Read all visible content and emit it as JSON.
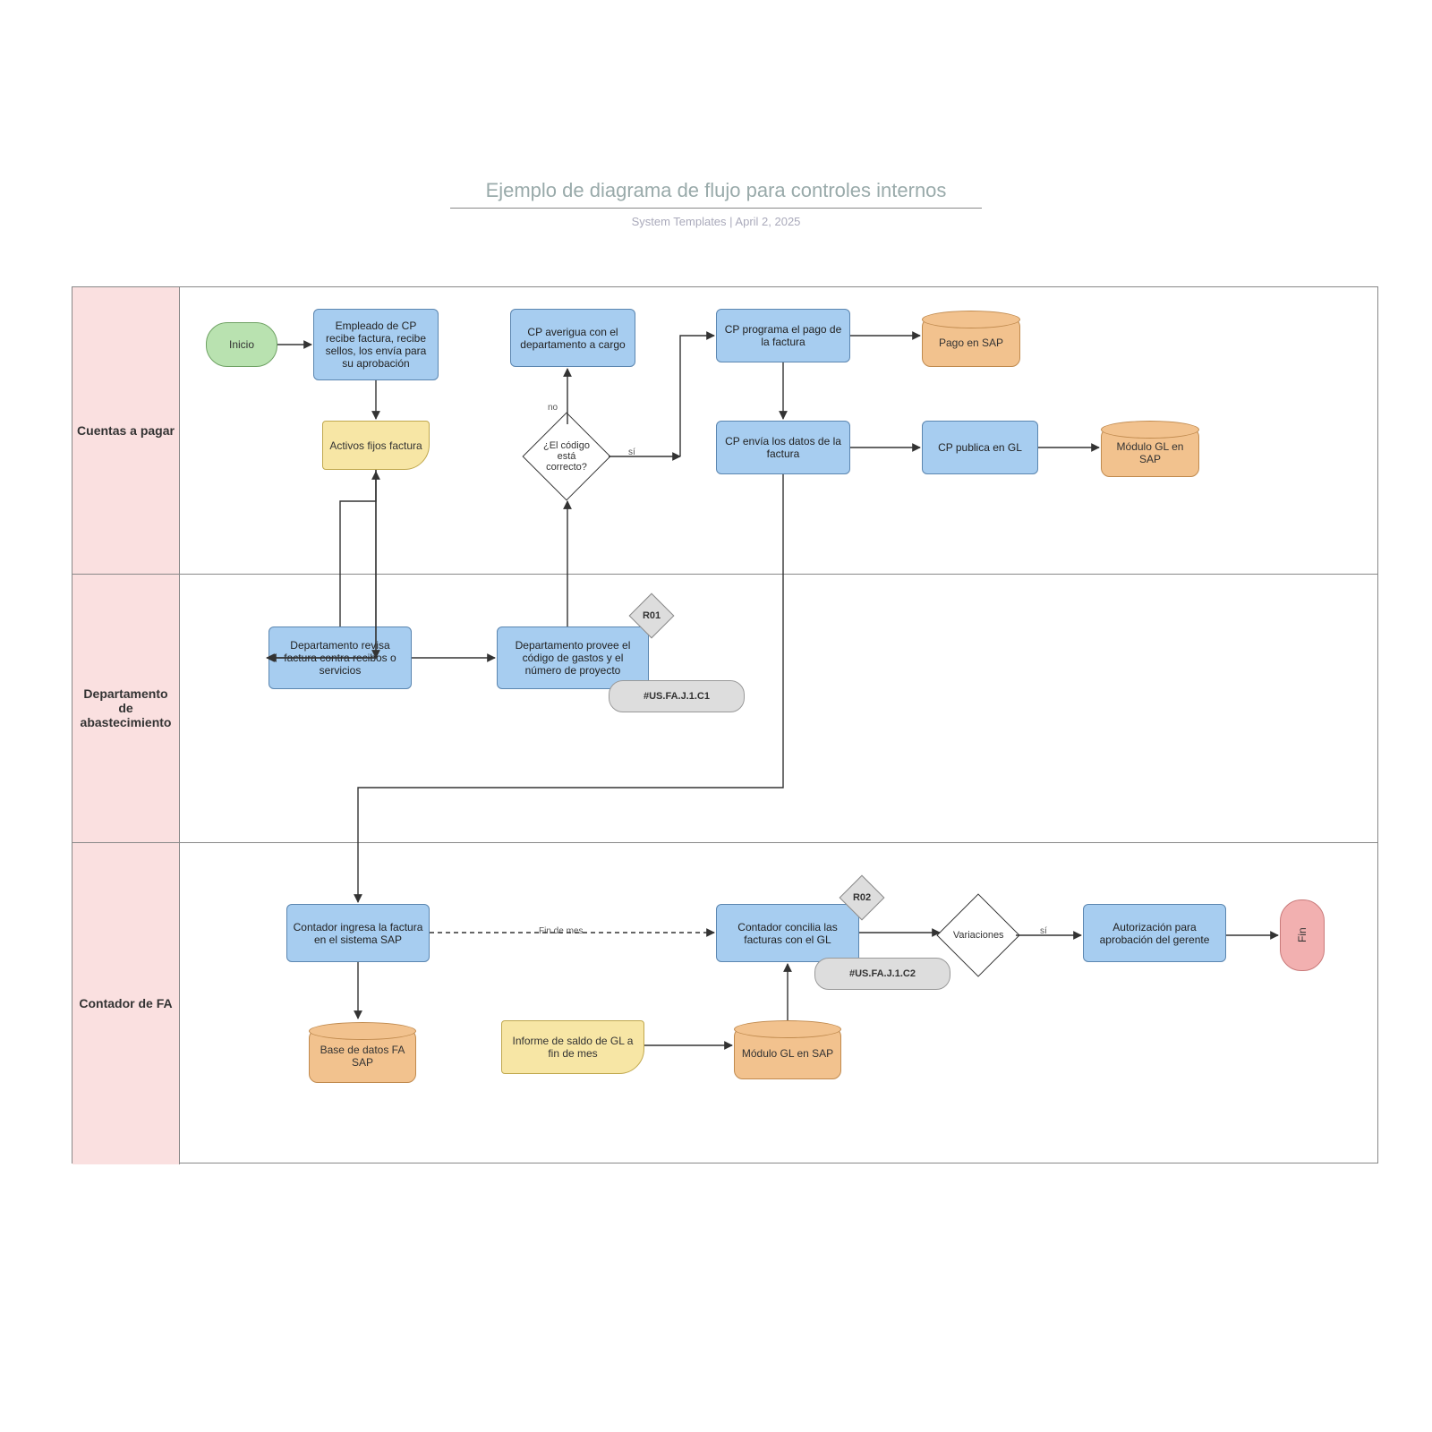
{
  "title": "Ejemplo de diagrama de flujo para controles internos",
  "meta": {
    "author": "System Templates",
    "date": "April 2, 2025",
    "sep": "  |  "
  },
  "lanes": {
    "l1": "Cuentas a pagar",
    "l2": "Departamento de abastecimiento",
    "l3": "Contador de FA"
  },
  "nodes": {
    "start": "Inicio",
    "end": "Fin",
    "p1": "Empleado de CP recibe factura, recibe sellos, los envía para su aprobación",
    "d1": "Activos fijos factura",
    "p2": "CP averigua con el departamento a cargo",
    "q1": "¿El código está correcto?",
    "p3": "CP programa el pago de la factura",
    "c1": "Pago en SAP",
    "p4": "CP envía los datos de la factura",
    "p5": "CP publica en GL",
    "c2": "Módulo GL en SAP",
    "p6": "Departamento revisa factura contra recibos o servicios",
    "p7": "Departamento provee el código de gastos y el número de proyecto",
    "r1": "R01",
    "t1": "#US.FA.J.1.C1",
    "p8": "Contador ingresa la factura en el sistema SAP",
    "c3": "Base de datos FA SAP",
    "d2": "Informe de saldo de GL a fin de mes",
    "c4": "Módulo GL en SAP",
    "p9": "Contador concilia las facturas con el GL",
    "r2": "R02",
    "t2": "#US.FA.J.1.C2",
    "q2": "Variaciones",
    "p10": "Autorización para aprobación del gerente",
    "eom": "Fin de mes"
  },
  "labels": {
    "yes": "sí",
    "no": "no"
  }
}
